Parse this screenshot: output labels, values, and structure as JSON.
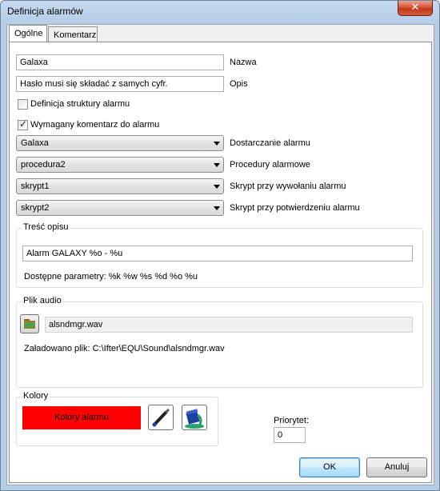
{
  "window": {
    "title": "Definicja alarmów",
    "close_glyph": "✕"
  },
  "tabs": [
    {
      "label": "Ogólne",
      "active": true
    },
    {
      "label": "Komentarz",
      "active": false
    }
  ],
  "form": {
    "name_value": "Galaxa",
    "name_label": "Nazwa",
    "desc_value": "Hasło musi się składać z samych cyfr.",
    "desc_label": "Opis",
    "struct_checkbox_label": "Definicja struktury alarmu",
    "struct_checked": false,
    "comment_checkbox_label": "Wymagany komentarz do alarmu",
    "comment_checked": true,
    "check_glyph": "✓",
    "delivery_value": "Galaxa",
    "delivery_label": "Dostarczanie alarmu",
    "procedures_value": "procedura2",
    "procedures_label": "Procedury alarmowe",
    "script_call_value": "skrypt1",
    "script_call_label": "Skrypt przy wywołaniu alarmu",
    "script_confirm_value": "skrypt2",
    "script_confirm_label": "Skrypt przy potwierdzeniu alarmu"
  },
  "description_group": {
    "title": "Treść opisu",
    "text_value": "Alarm GALAXY %o - %u",
    "params_text": "Dostępne parametry: %k  %w  %s  %d  %o  %u"
  },
  "audio_group": {
    "title": "Plik audio",
    "file_value": "alsndmgr.wav",
    "loaded_text": "Załadowano plik: C:\\Ifter\\EQU\\Sound\\alsndmgr.wav",
    "browse_icon": "folder-icon"
  },
  "colors_group": {
    "title": "Kolory",
    "swatch_label": "Kolory alarmu",
    "swatch_color": "#ff0000",
    "text_color_icon": "pen-icon",
    "fill_color_icon": "paint-bucket-icon"
  },
  "priority": {
    "label": "Priorytet:",
    "value": "0"
  },
  "buttons": {
    "ok": "OK",
    "cancel": "Anuluj"
  },
  "colors": {
    "title_bar": "#b6cde8",
    "accent": "#3c7fb1",
    "close": "#c3381a"
  }
}
